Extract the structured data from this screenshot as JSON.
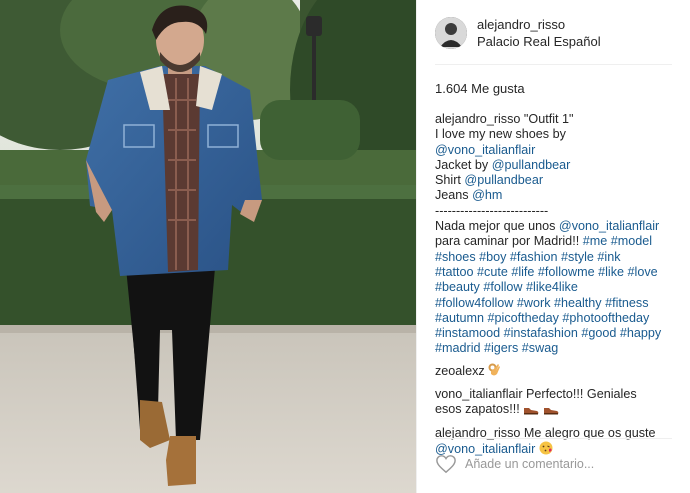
{
  "post": {
    "username": "alejandro_risso",
    "location": "Palacio Real Español",
    "likes": "1.604 Me gusta"
  },
  "caption": {
    "author": "alejandro_risso",
    "lines": {
      "l1": "\"Outfit 1\"",
      "l2": "I love my new shoes by",
      "l3_tag": "@vono_italianflair",
      "l4_text": "Jacket by ",
      "l4_tag": "@pullandbear",
      "l5_text": "Shirt ",
      "l5_tag": "@pullandbear",
      "l6_text": "Jeans ",
      "l6_tag": "@hm",
      "l7": "---------------------------",
      "l8_text": "Nada mejor que unos ",
      "l8_tag": "@vono_italianflair",
      "l9_text": "para caminar por Madrid!! ",
      "l9_tags": "#me #model",
      "l10": "#shoes #boy #fashion #style #ink",
      "l11": "#tattoo #cute #life #followme #like #love",
      "l12": "#beauty #follow #like4like",
      "l13": "#follow4follow #work #healthy #fitness",
      "l14": "#autumn #picoftheday #photooftheday",
      "l15": "#instamood #instafashion #good #happy",
      "l16": "#madrid #igers #swag"
    }
  },
  "comments": [
    {
      "author": "zeoalexz",
      "text": "",
      "emoji": "ok-hand-icon"
    },
    {
      "author": "vono_italianflair",
      "text": "Perfecto!!! Geniales",
      "text2": "esos zapatos!!!",
      "emoji": "shoe-icon"
    },
    {
      "author": "alejandro_risso",
      "text": "Me alegro que os guste",
      "tag": "@vono_italianflair",
      "emoji": "kiss-face-icon"
    }
  ],
  "add_comment": {
    "placeholder": "Añade un comentario..."
  },
  "colors": {
    "link": "#1a5b8f",
    "text": "#262626",
    "muted": "#999999",
    "divider": "#efefef"
  }
}
